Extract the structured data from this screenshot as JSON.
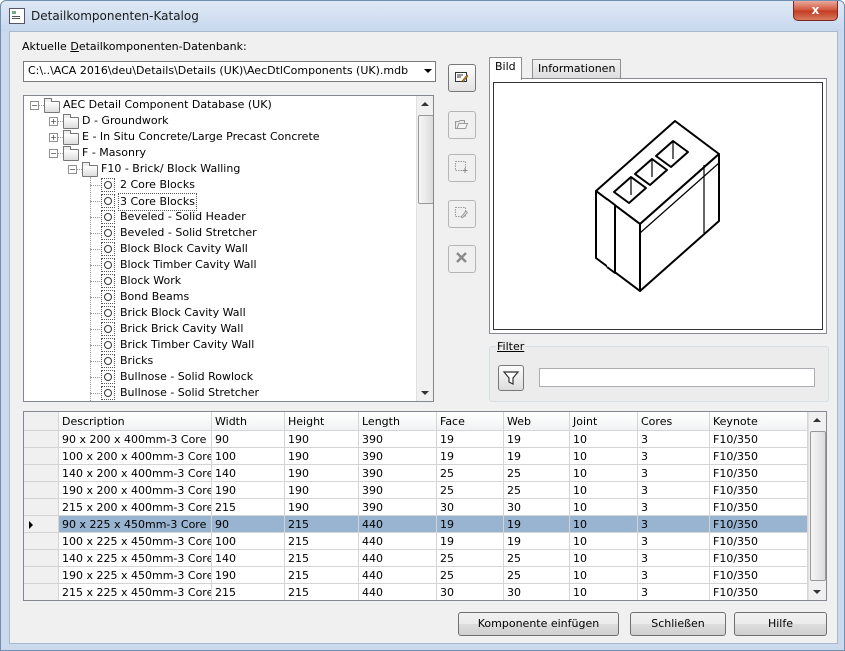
{
  "window": {
    "title": "Detailkomponenten-Katalog",
    "close_label": "x"
  },
  "database": {
    "label": "Aktuelle Detailkomponenten-Datenbank:",
    "label_accel": "D",
    "label_pre": "Aktuelle ",
    "label_post": "etailkomponenten-Datenbank:",
    "path": "C:\\..\\ACA 2016\\deu\\Details\\Details (UK)\\AecDtlComponents (UK).mdb"
  },
  "tree": {
    "items": [
      {
        "label": "AEC Detail Component Database (UK)",
        "type": "folder",
        "expander": "−"
      },
      {
        "label": "D - Groundwork",
        "type": "folder",
        "expander": "+"
      },
      {
        "label": "E - In Situ Concrete/Large Precast Concrete",
        "type": "folder",
        "expander": "+"
      },
      {
        "label": "F - Masonry",
        "type": "folder",
        "expander": "−"
      },
      {
        "label": "F10 - Brick/ Block Walling",
        "type": "folder",
        "expander": "−"
      },
      {
        "label": "2 Core Blocks",
        "type": "component"
      },
      {
        "label": "3 Core Blocks",
        "type": "component",
        "selected": true
      },
      {
        "label": "Beveled - Solid Header",
        "type": "component"
      },
      {
        "label": "Beveled - Solid Stretcher",
        "type": "component"
      },
      {
        "label": "Block Block Cavity Wall",
        "type": "component"
      },
      {
        "label": "Block Timber Cavity Wall",
        "type": "component"
      },
      {
        "label": "Block Work",
        "type": "component"
      },
      {
        "label": "Bond Beams",
        "type": "component"
      },
      {
        "label": "Brick Block Cavity Wall",
        "type": "component"
      },
      {
        "label": "Brick Brick Cavity Wall",
        "type": "component"
      },
      {
        "label": "Brick Timber Cavity Wall",
        "type": "component"
      },
      {
        "label": "Bricks",
        "type": "component"
      },
      {
        "label": "Bullnose - Solid Rowlock",
        "type": "component"
      },
      {
        "label": "Bullnose - Solid Stretcher",
        "type": "component"
      }
    ]
  },
  "side_buttons": [
    {
      "icon": "edit-database-icon",
      "enabled": true
    },
    {
      "icon": "open-folder-icon",
      "enabled": false
    },
    {
      "icon": "add-component-icon",
      "enabled": false
    },
    {
      "icon": "edit-component-icon",
      "enabled": false
    },
    {
      "icon": "delete-icon",
      "enabled": false
    }
  ],
  "tabs": [
    {
      "label": "Bild",
      "active": true
    },
    {
      "label": "Informationen",
      "active": false
    }
  ],
  "filter": {
    "label": "Filter",
    "value": ""
  },
  "grid": {
    "columns": [
      "Description",
      "Width",
      "Height",
      "Length",
      "Face",
      "Web",
      "Joint",
      "Cores",
      "Keynote"
    ],
    "rows": [
      [
        "90 x 200 x 400mm-3 Core",
        "90",
        "190",
        "390",
        "19",
        "19",
        "10",
        "3",
        "F10/350"
      ],
      [
        "100 x 200 x 400mm-3 Core",
        "100",
        "190",
        "390",
        "19",
        "19",
        "10",
        "3",
        "F10/350"
      ],
      [
        "140 x 200 x 400mm-3 Core",
        "140",
        "190",
        "390",
        "25",
        "25",
        "10",
        "3",
        "F10/350"
      ],
      [
        "190 x 200 x 400mm-3 Core",
        "190",
        "190",
        "390",
        "25",
        "25",
        "10",
        "3",
        "F10/350"
      ],
      [
        "215 x 200 x 400mm-3 Core",
        "215",
        "190",
        "390",
        "30",
        "30",
        "10",
        "3",
        "F10/350"
      ],
      [
        "90 x 225 x 450mm-3 Core",
        "90",
        "215",
        "440",
        "19",
        "19",
        "10",
        "3",
        "F10/350"
      ],
      [
        "100 x 225 x 450mm-3 Core",
        "100",
        "215",
        "440",
        "19",
        "19",
        "10",
        "3",
        "F10/350"
      ],
      [
        "140 x 225 x 450mm-3 Core",
        "140",
        "215",
        "440",
        "25",
        "25",
        "10",
        "3",
        "F10/350"
      ],
      [
        "190 x 225 x 450mm-3 Core",
        "190",
        "215",
        "440",
        "25",
        "25",
        "10",
        "3",
        "F10/350"
      ],
      [
        "215 x 225 x 450mm-3 Core",
        "215",
        "215",
        "440",
        "30",
        "30",
        "10",
        "3",
        "F10/350"
      ]
    ],
    "selected_row": 5
  },
  "buttons": {
    "insert": "Komponente einfügen",
    "close": "Schließen",
    "help": "Hilfe"
  },
  "colors": {
    "selection": "#99b4d1",
    "title_gradient_top": "#dfe9f5",
    "close_red": "#c23a20"
  }
}
